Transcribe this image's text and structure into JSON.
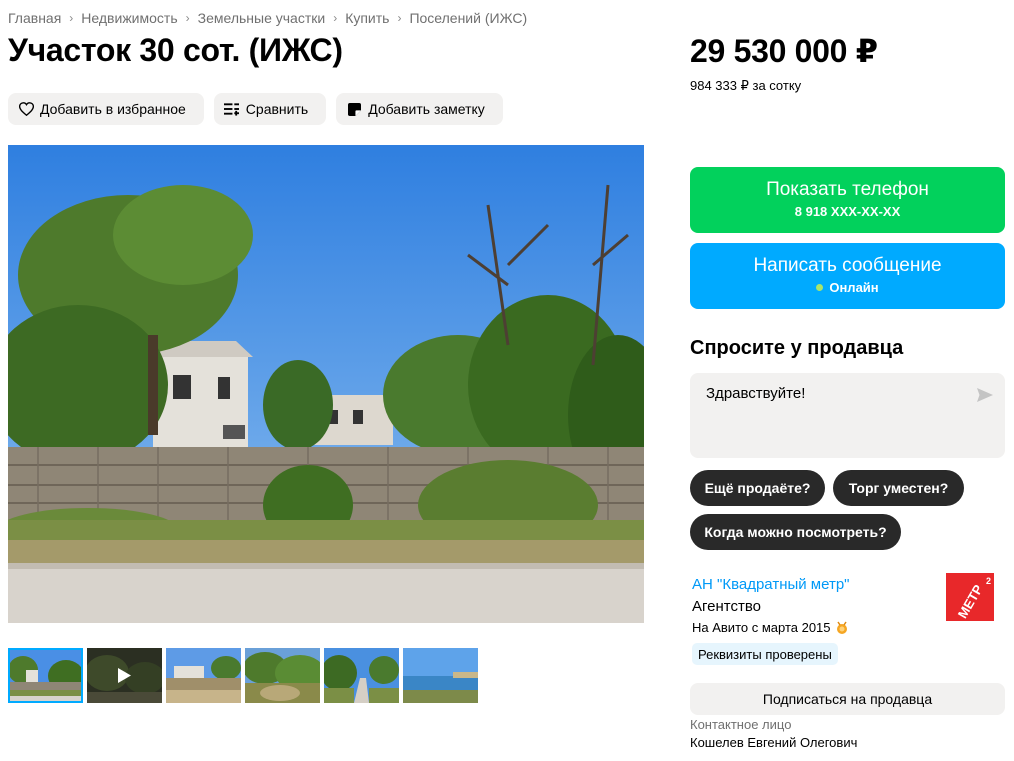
{
  "breadcrumb": [
    "Главная",
    "Недвижимость",
    "Земельные участки",
    "Купить",
    "Поселений (ИЖС)"
  ],
  "title": "Участок 30 сот. (ИЖС)",
  "actions": {
    "favorite": "Добавить в избранное",
    "compare": "Сравнить",
    "note": "Добавить заметку"
  },
  "price": {
    "total": "29 530 000 ₽",
    "per_unit": "984 333 ₽ за сотку"
  },
  "contact_buttons": {
    "phone_label": "Показать телефон",
    "phone_masked": "8 918 XXX-XX-XX",
    "message_label": "Написать сообщение",
    "online_status": "Онлайн"
  },
  "ask": {
    "title": "Спросите у продавца",
    "draft": "Здравствуйте!",
    "quick_replies": [
      "Ещё продаёте?",
      "Торг уместен?",
      "Когда можно посмотреть?"
    ]
  },
  "seller": {
    "name": "АН \"Квадратный метр\"",
    "type": "Агентство",
    "since": "На Авито с марта 2015",
    "verified_badge": "Реквизиты проверены",
    "logo_text": "МЕТР",
    "logo_superscript": "2",
    "subscribe_label": "Подписаться на продавца",
    "contact_label": "Контактное лицо",
    "contact_name": "Кошелев Евгений Олегович"
  },
  "gallery": {
    "thumbnail_count": 6,
    "active_index": 0,
    "video_index": 1
  },
  "colors": {
    "phone_button": "#02d15c",
    "message_button": "#00aaff",
    "link": "#0099f7",
    "chip": "#292929",
    "secondary_bg": "#f2f1f0"
  }
}
